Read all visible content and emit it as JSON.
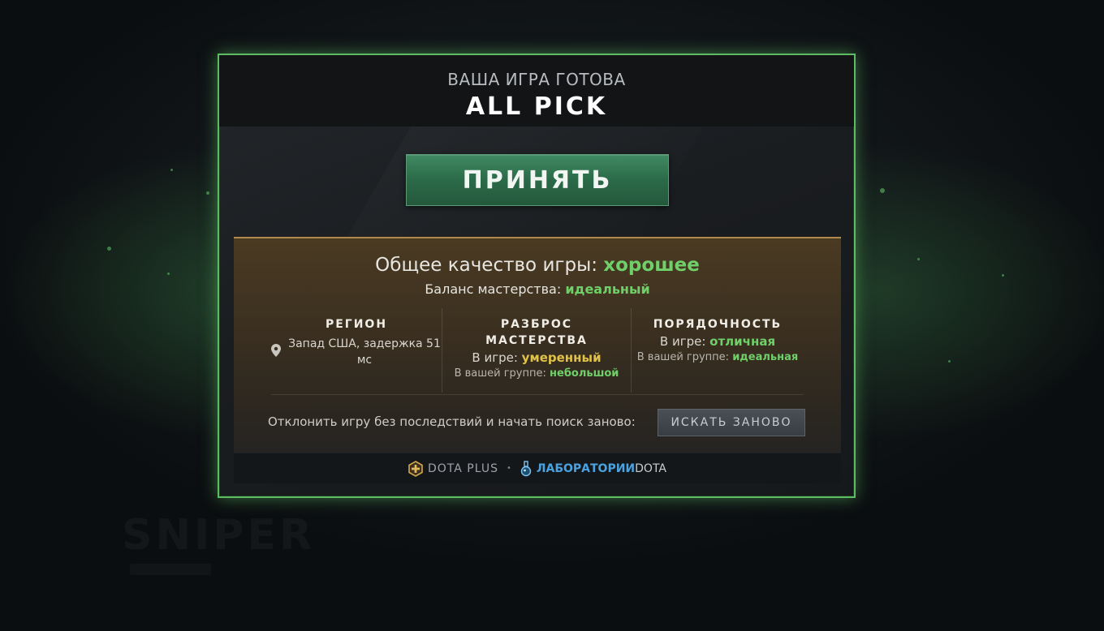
{
  "background": {
    "ghost_text": "SNIPER"
  },
  "dialog": {
    "ready_title": "ВАША ИГРА ГОТОВА",
    "mode_title": "ALL PICK",
    "accept_label": "ПРИНЯТЬ",
    "quality": {
      "overall_label": "Общее качество игры:",
      "overall_value": "хорошее",
      "balance_label": "Баланс мастерства:",
      "balance_value": "идеальный"
    },
    "region": {
      "heading": "РЕГИОН",
      "value": "Запад США, задержка 51 мс"
    },
    "skill_spread": {
      "heading_line1": "РАЗБРОС",
      "heading_line2": "МАСТЕРСТВА",
      "in_game_label": "В игре:",
      "in_game_value": "умеренный",
      "in_group_label": "В вашей группе:",
      "in_group_value": "небольшой"
    },
    "behavior": {
      "heading": "ПОРЯДОЧНОСТЬ",
      "in_game_label": "В игре:",
      "in_game_value": "отличная",
      "in_group_label": "В вашей группе:",
      "in_group_value": "идеальная"
    },
    "decline_text": "Отклонить игру без последствий и начать поиск заново:",
    "research_label": "ИСКАТЬ ЗАНОВО",
    "footer": {
      "dotaplus": "DOTA PLUS",
      "separator": "•",
      "labs_part1": "ЛАБОРАТОРИИ",
      "labs_part2": "DOTA"
    }
  },
  "colors": {
    "accent_green": "#6fcf68",
    "warning_yellow": "#e0c14a",
    "border_glow": "#5dbb63",
    "labs_blue": "#4aa3e0"
  }
}
